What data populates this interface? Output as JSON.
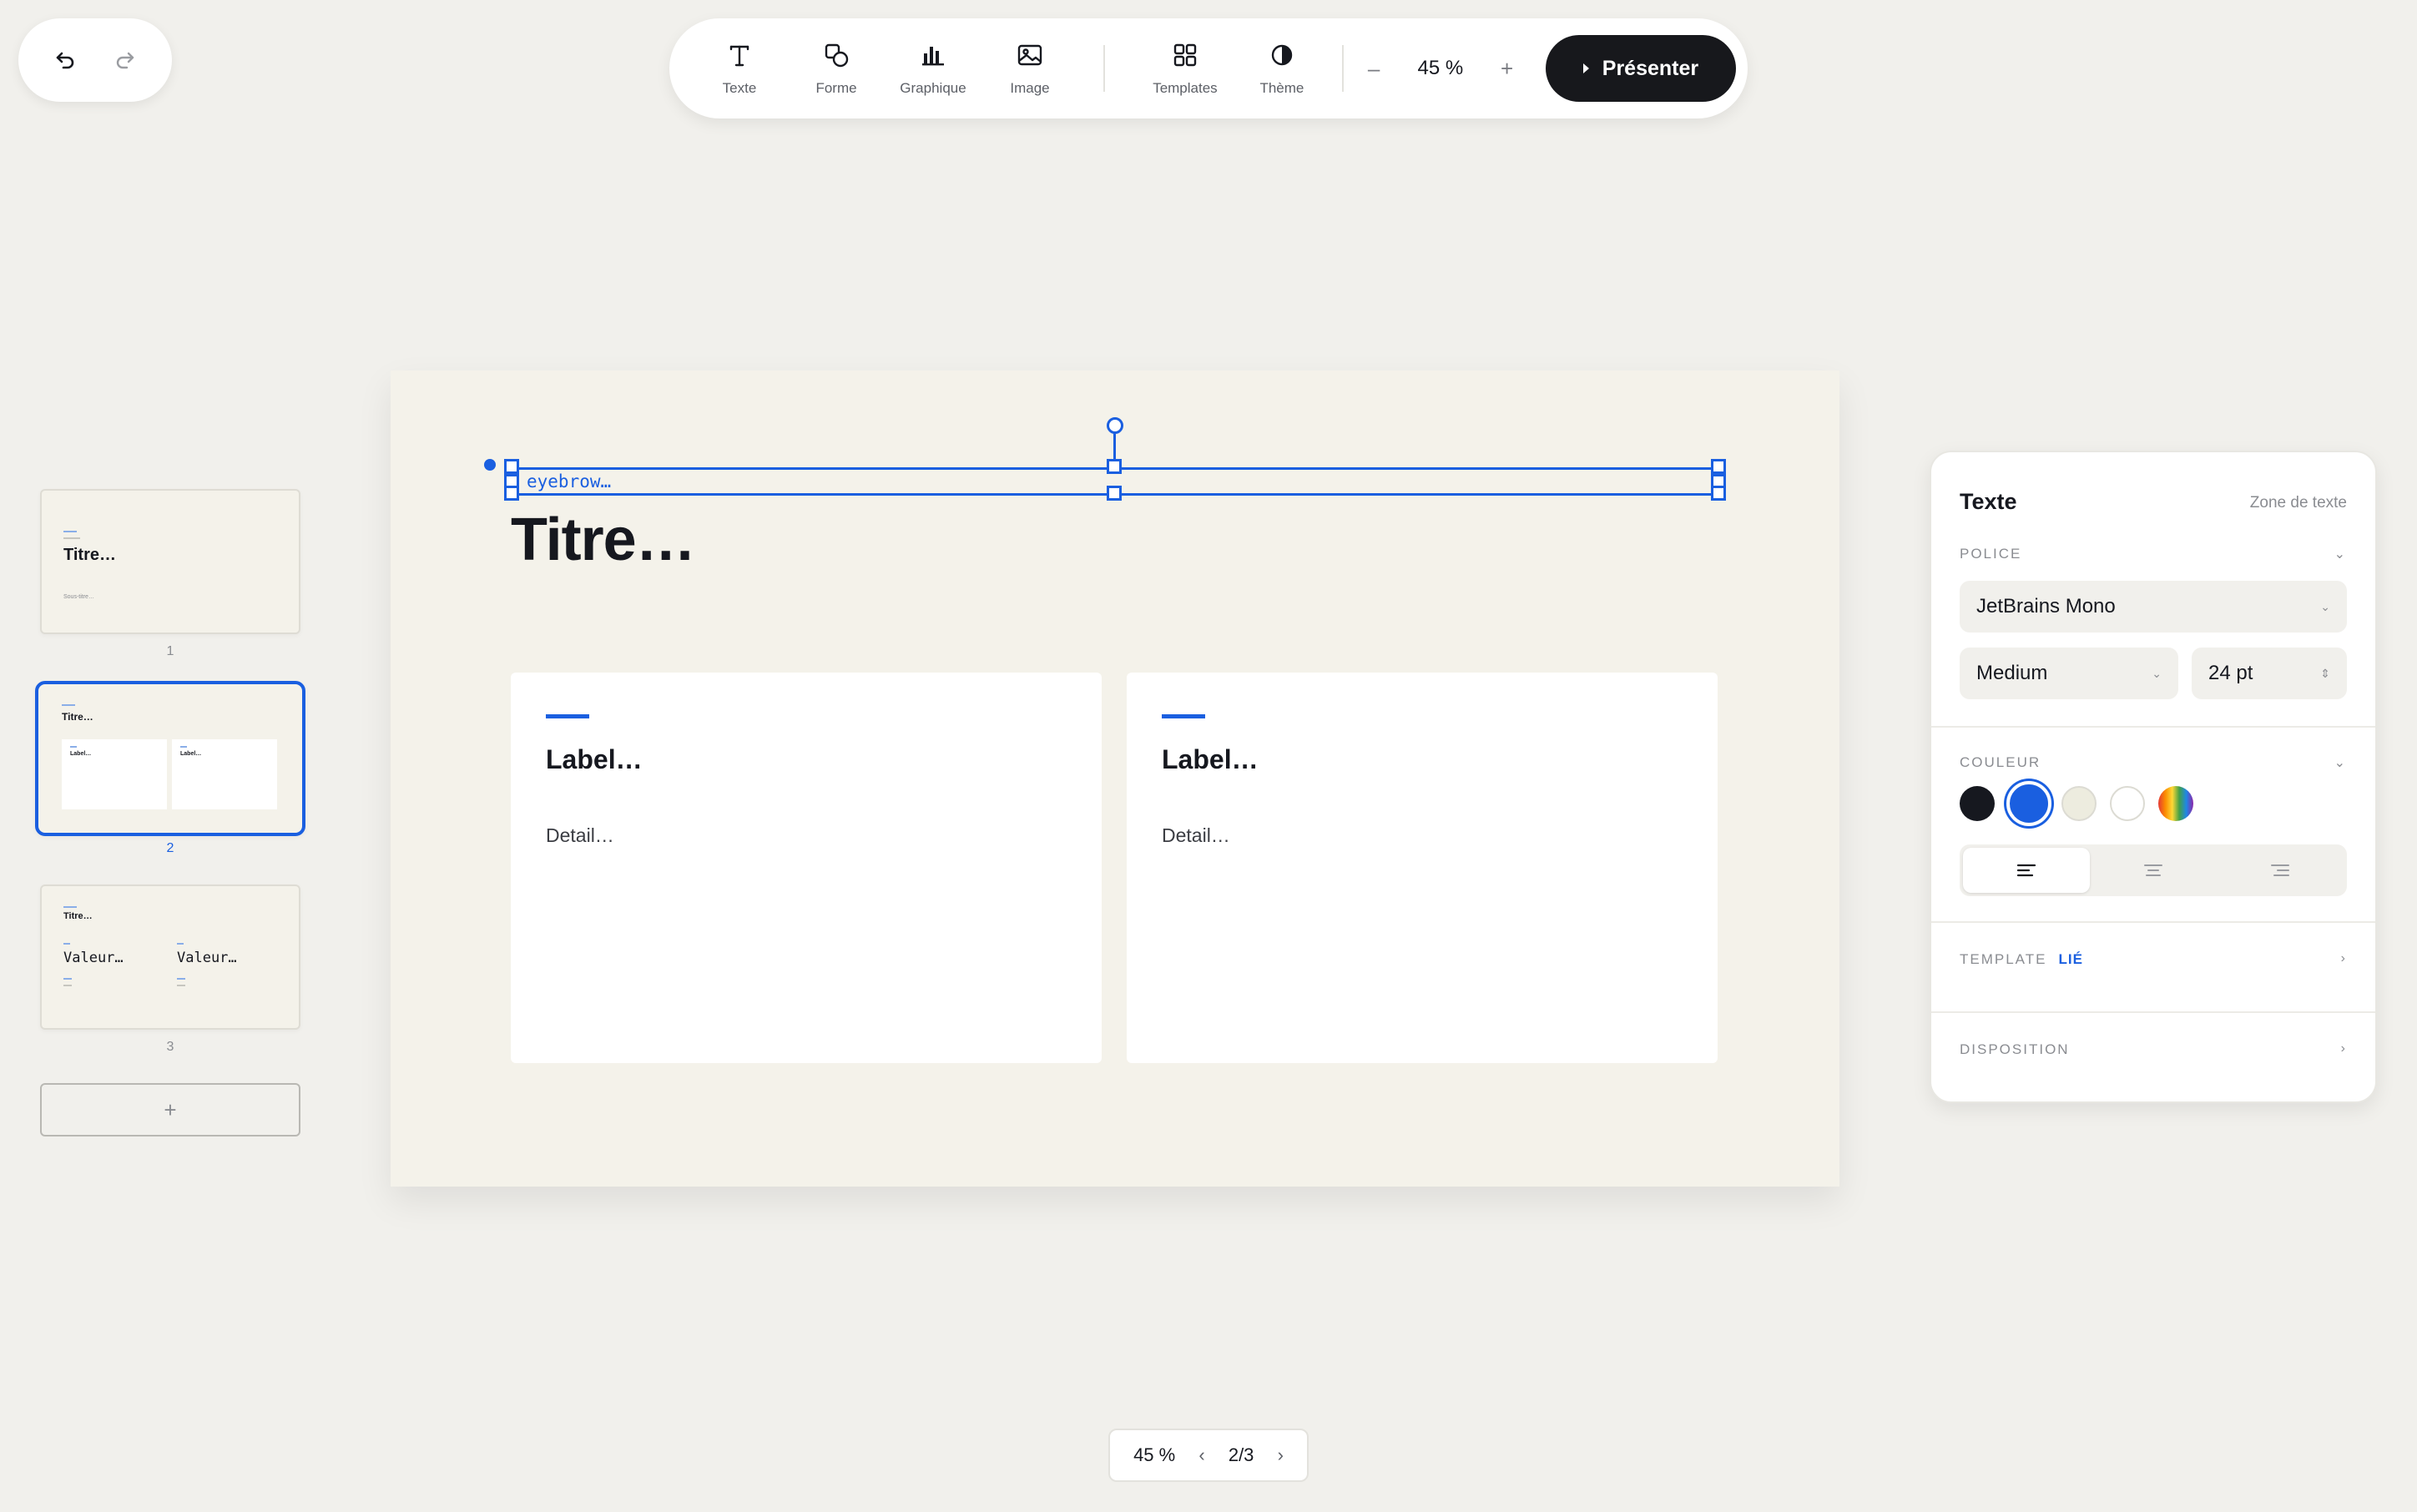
{
  "toolbar": {
    "tools": [
      {
        "label": "Texte",
        "icon": "text-icon"
      },
      {
        "label": "Forme",
        "icon": "shape-icon"
      },
      {
        "label": "Graphique",
        "icon": "chart-icon"
      },
      {
        "label": "Image",
        "icon": "image-icon"
      },
      {
        "label": "Templates",
        "icon": "templates-icon"
      },
      {
        "label": "Thème",
        "icon": "theme-icon"
      }
    ],
    "zoom_minus": "–",
    "zoom_value": "45 %",
    "zoom_plus": "+",
    "present_label": "Présenter"
  },
  "thumbnails": [
    {
      "number": "1",
      "title": "Titre…",
      "subtitle": "Sous-titre…"
    },
    {
      "number": "2",
      "title": "Titre…",
      "card_label": "Label…"
    },
    {
      "number": "3",
      "title": "Titre…",
      "value_1": "Valeur…",
      "value_2": "Valeur…"
    }
  ],
  "add_slide": "+",
  "slide": {
    "eyebrow": "eyebrow…",
    "title": "Titre…",
    "cards": [
      {
        "label": "Label…",
        "detail": "Detail…"
      },
      {
        "label": "Label…",
        "detail": "Detail…"
      }
    ]
  },
  "panel": {
    "title": "Texte",
    "type": "Zone de texte",
    "police_label": "POLICE",
    "font_family": "JetBrains Mono",
    "font_weight": "Medium",
    "font_size": "24 pt",
    "couleur_label": "COULEUR",
    "swatches": [
      "#16181f",
      "#1a5fe0",
      "#edecdf",
      "#ffffff"
    ],
    "selected_swatch": "#1a5fe0",
    "alignment": "left",
    "template_label": "TEMPLATE",
    "template_badge": "LIÉ",
    "disposition_label": "DISPOSITION"
  },
  "status": {
    "zoom": "45 %",
    "page": "2/3"
  },
  "accent_color": "#1a5fe0"
}
